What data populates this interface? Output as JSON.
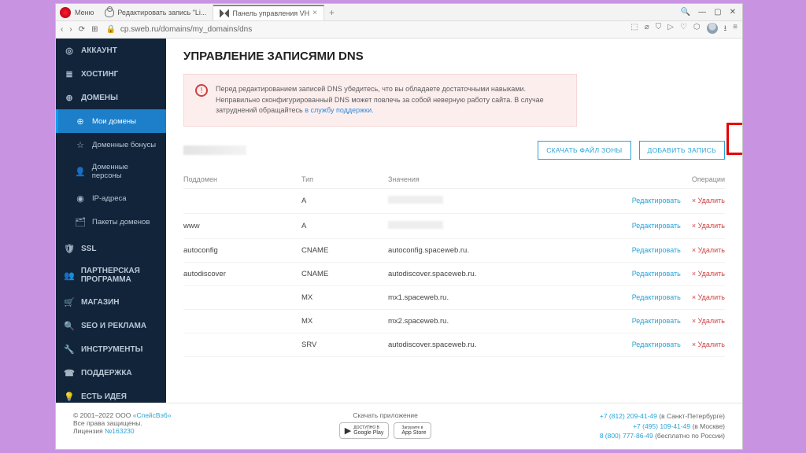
{
  "window": {
    "menu_label": "Меню",
    "tabs": [
      {
        "label": "Редактировать запись \"Li..."
      },
      {
        "label": "Панель управления VH",
        "active": true
      }
    ],
    "win_min": "—",
    "win_max": "▢",
    "win_close": "✕",
    "search_icon": "🔍"
  },
  "address": {
    "url": "cp.sweb.ru/domains/my_domains/dns",
    "nav_back": "‹",
    "nav_fwd": "›",
    "reload": "⟳",
    "apps": "⊞",
    "lock": "🔒"
  },
  "sidebar": {
    "items": [
      {
        "icon": "◎",
        "label": "АККАУНТ"
      },
      {
        "icon": "≣",
        "label": "ХОСТИНГ"
      },
      {
        "icon": "⊕",
        "label": "ДОМЕНЫ",
        "expanded": true
      },
      {
        "icon": "⊕",
        "label": "Мои домены",
        "sub": true,
        "active": true
      },
      {
        "icon": "☆",
        "label": "Доменные бонусы",
        "sub": true
      },
      {
        "icon": "👤",
        "label": "Доменные персоны",
        "sub": true
      },
      {
        "icon": "◉",
        "label": "IP-адреса",
        "sub": true
      },
      {
        "icon": "🗂",
        "label": "Пакеты доменов",
        "sub": true
      },
      {
        "icon": "🛡",
        "label": "SSL"
      },
      {
        "icon": "👥",
        "label": "ПАРТНЕРСКАЯ ПРОГРАММА"
      },
      {
        "icon": "🛒",
        "label": "МАГАЗИН"
      },
      {
        "icon": "🔍",
        "label": "SEO И РЕКЛАМА"
      },
      {
        "icon": "🔧",
        "label": "ИНСТРУМЕНТЫ"
      },
      {
        "icon": "☎",
        "label": "ПОДДЕРЖКА"
      },
      {
        "icon": "💡",
        "label": "ЕСТЬ ИДЕЯ"
      }
    ]
  },
  "page": {
    "title": "УПРАВЛЕНИЕ ЗАПИСЯМИ DNS",
    "alert": "Перед редактированием записей DNS убедитесь, что вы обладаете достаточными навыками. Неправильно сконфигурированный DNS может повлечь за собой неверную работу сайта. В случае затруднений обращайтесь ",
    "alert_link": "в службу поддержки.",
    "btn_download": "СКАЧАТЬ ФАЙЛ ЗОНЫ",
    "btn_add": "ДОБАВИТЬ ЗАПИСЬ"
  },
  "table": {
    "head": {
      "sub": "Поддомен",
      "type": "Тип",
      "val": "Значения",
      "ops": "Операции"
    },
    "rows": [
      {
        "sub": "",
        "type": "A",
        "val": "",
        "blur_val": true,
        "edit": "Редактировать",
        "del": "Удалить"
      },
      {
        "sub": "www",
        "type": "A",
        "val": "",
        "blur_val": true,
        "edit": "Редактировать",
        "del": "Удалить"
      },
      {
        "sub": "autoconfig",
        "type": "CNAME",
        "val": "autoconfig.spaceweb.ru.",
        "edit": "Редактировать",
        "del": "Удалить"
      },
      {
        "sub": "autodiscover",
        "type": "CNAME",
        "val": "autodiscover.spaceweb.ru.",
        "edit": "Редактировать",
        "del": "Удалить"
      },
      {
        "sub": "",
        "type": "MX",
        "val": "mx1.spaceweb.ru.",
        "edit": "Редактировать",
        "del": "Удалить"
      },
      {
        "sub": "",
        "type": "MX",
        "val": "mx2.spaceweb.ru.",
        "edit": "Редактировать",
        "del": "Удалить"
      },
      {
        "sub": "",
        "type": "SRV",
        "val": "autodiscover.spaceweb.ru.",
        "edit": "Редактировать",
        "del": "Удалить"
      }
    ]
  },
  "footer": {
    "copy_prefix": "© 2001–2022 ООО ",
    "copy_link": "«СпейсВэб»",
    "rights": "Все права защищены.",
    "lic_prefix": "Лицензия ",
    "lic": "№163230",
    "center_title": "Скачать приложение",
    "gp_small": "ДОСТУПНО В",
    "gp_big": "Google Play",
    "as_small": "Загрузите в",
    "as_big": "App Store",
    "phone1": "+7 (812) 209-41-49",
    "phone1_sfx": " (в Санкт-Петербурге)",
    "phone2": "+7 (495) 109-41-49",
    "phone2_sfx": " (в Москве)",
    "phone3": "8 (800) 777-86-49",
    "phone3_sfx": " (бесплатно по России)"
  }
}
